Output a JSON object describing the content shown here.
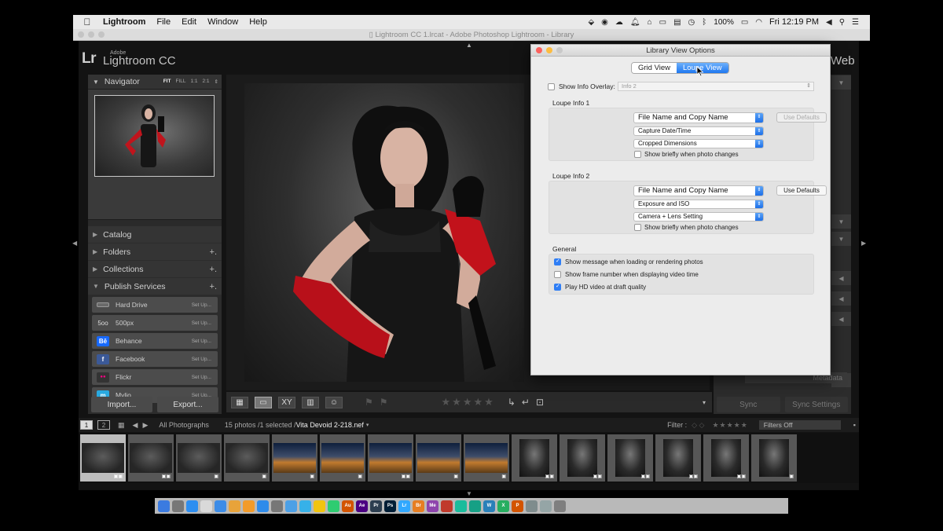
{
  "menubar": {
    "app": "Lightroom",
    "items": [
      "File",
      "Edit",
      "Window",
      "Help"
    ],
    "battery": "100%",
    "clock": "Fri 12:19 PM"
  },
  "window": {
    "title": "Lightroom CC 1.lrcat - Adobe Photoshop Lightroom - Library"
  },
  "app": {
    "logo_mark": "Lr",
    "logo_adobe": "Adobe",
    "logo_name": "Lightroom CC",
    "module_partial": "Web"
  },
  "leftpanel": {
    "navigator": {
      "label": "Navigator",
      "options": [
        "FIT",
        "FILL",
        "1:1",
        "2:1"
      ]
    },
    "sections": [
      "Catalog",
      "Folders",
      "Collections",
      "Publish Services"
    ],
    "services": [
      {
        "label": "Hard Drive",
        "icon": "hard-drive-icon",
        "icon_text": "",
        "color": "#6a6a6a",
        "setup": "Set Up..."
      },
      {
        "label": "500px",
        "icon": "500px-icon",
        "icon_text": "5oo",
        "color": "#4c4c4c",
        "setup": "Set Up..."
      },
      {
        "label": "Behance",
        "icon": "behance-icon",
        "icon_text": "Bē",
        "color": "#1769ff",
        "setup": "Set Up..."
      },
      {
        "label": "Facebook",
        "icon": "facebook-icon",
        "icon_text": "f",
        "color": "#3b5998",
        "setup": "Set Up..."
      },
      {
        "label": "Flickr",
        "icon": "flickr-icon",
        "icon_text": "●●",
        "color": "#ff0084",
        "setup": "Set Up..."
      },
      {
        "label": "Mylio",
        "icon": "mylio-icon",
        "icon_text": "m",
        "color": "#29a9e0",
        "setup": "Set Up..."
      }
    ],
    "import_label": "Import...",
    "export_label": "Export..."
  },
  "rightpanel": {
    "metadata_partial": "Metadata",
    "sync_label": "Sync",
    "sync_settings_label": "Sync Settings"
  },
  "filmbar": {
    "view1": "1",
    "view2": "2",
    "source": "All Photographs",
    "count": "15 photos /1 selected /",
    "filename": "Vita Devoid 2-218.nef",
    "filter_label": "Filter :",
    "filters_off": "Filters Off"
  },
  "dialog": {
    "title": "Library View Options",
    "tabs": [
      "Grid View",
      "Loupe View"
    ],
    "active_tab": "Loupe View",
    "show_info_overlay": "Show Info Overlay:",
    "overlay_value": "Info 2",
    "loupe1": {
      "label": "Loupe Info 1",
      "field1": "File Name and Copy Name",
      "field2": "Capture Date/Time",
      "field3": "Cropped Dimensions",
      "brief": "Show briefly when photo changes",
      "defaults": "Use Defaults"
    },
    "loupe2": {
      "label": "Loupe Info 2",
      "field1": "File Name and Copy Name",
      "field2": "Exposure and ISO",
      "field3": "Camera + Lens Setting",
      "brief": "Show briefly when photo changes",
      "defaults": "Use Defaults"
    },
    "general": {
      "label": "General",
      "opt1": "Show message when loading or rendering photos",
      "opt2": "Show frame number when displaying video time",
      "opt3": "Play HD video at draft quality"
    }
  },
  "colors": {
    "accent": "#1f78f0",
    "panel": "#2c2c2c",
    "dialog": "#ececec"
  }
}
